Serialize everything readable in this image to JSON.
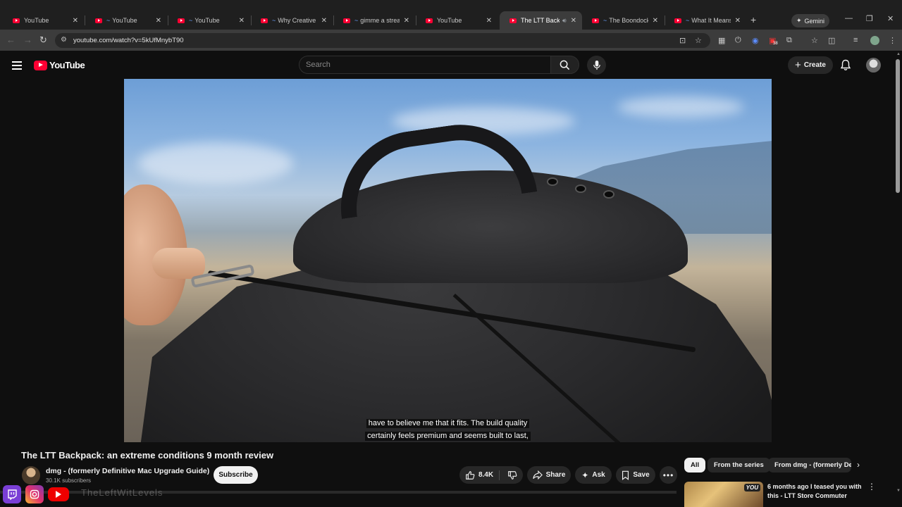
{
  "browser": {
    "tabs": [
      {
        "title": "YouTube",
        "active": false,
        "prefix": "",
        "audio": false
      },
      {
        "title": "YouTube",
        "active": false,
        "prefix": "~",
        "audio": false
      },
      {
        "title": "YouTube",
        "active": false,
        "prefix": "~",
        "audio": false
      },
      {
        "title": "Why Creative St",
        "active": false,
        "prefix": "~",
        "audio": false
      },
      {
        "title": "gimme a stream",
        "active": false,
        "prefix": "~",
        "audio": false
      },
      {
        "title": "YouTube",
        "active": false,
        "prefix": "",
        "audio": false
      },
      {
        "title": "The LTT Backpac",
        "active": true,
        "prefix": "",
        "audio": true
      },
      {
        "title": "The Boondocks",
        "active": false,
        "prefix": "~",
        "audio": false
      },
      {
        "title": "What It Means",
        "active": false,
        "prefix": "~",
        "audio": false
      }
    ],
    "new_tab": "+",
    "gemini_label": "Gemini",
    "window_controls": {
      "minimize": "—",
      "restore": "❐",
      "close": "✕"
    },
    "url": "youtube.com/watch?v=5kUfMnybT90",
    "toolbar_badge": "38"
  },
  "youtube": {
    "logo_text": "YouTube",
    "search_placeholder": "Search",
    "create_label": "Create"
  },
  "video": {
    "caption_line1": "have to believe me that it fits. The build quality",
    "caption_line2": "certainly feels premium and seems built to last,",
    "title": "The LTT Backpack: an extreme conditions 9 month review",
    "channel_name": "dmg - (formerly Definitive Mac Upgrade Guide)",
    "subscribers": "30.1K subscribers",
    "subscribe_label": "Subscribe",
    "likes": "8.4K",
    "share_label": "Share",
    "ask_label": "Ask",
    "save_label": "Save",
    "more_label": "•••"
  },
  "sidebar": {
    "chips": [
      {
        "label": "All",
        "active": true
      },
      {
        "label": "From the series",
        "active": false
      },
      {
        "label": "From dmg - (formerly Def",
        "active": false
      }
    ],
    "next_arrow": "›",
    "recommendation": {
      "title": "6 months ago I teased you with this - LTT Store Commuter",
      "badge": "YOU",
      "menu": "⋮"
    }
  },
  "overlay": {
    "text": "TheLeftWitLevels"
  },
  "colors": {
    "brand_red": "#ff0033",
    "background": "#0f0f0f",
    "pill": "#272727"
  }
}
